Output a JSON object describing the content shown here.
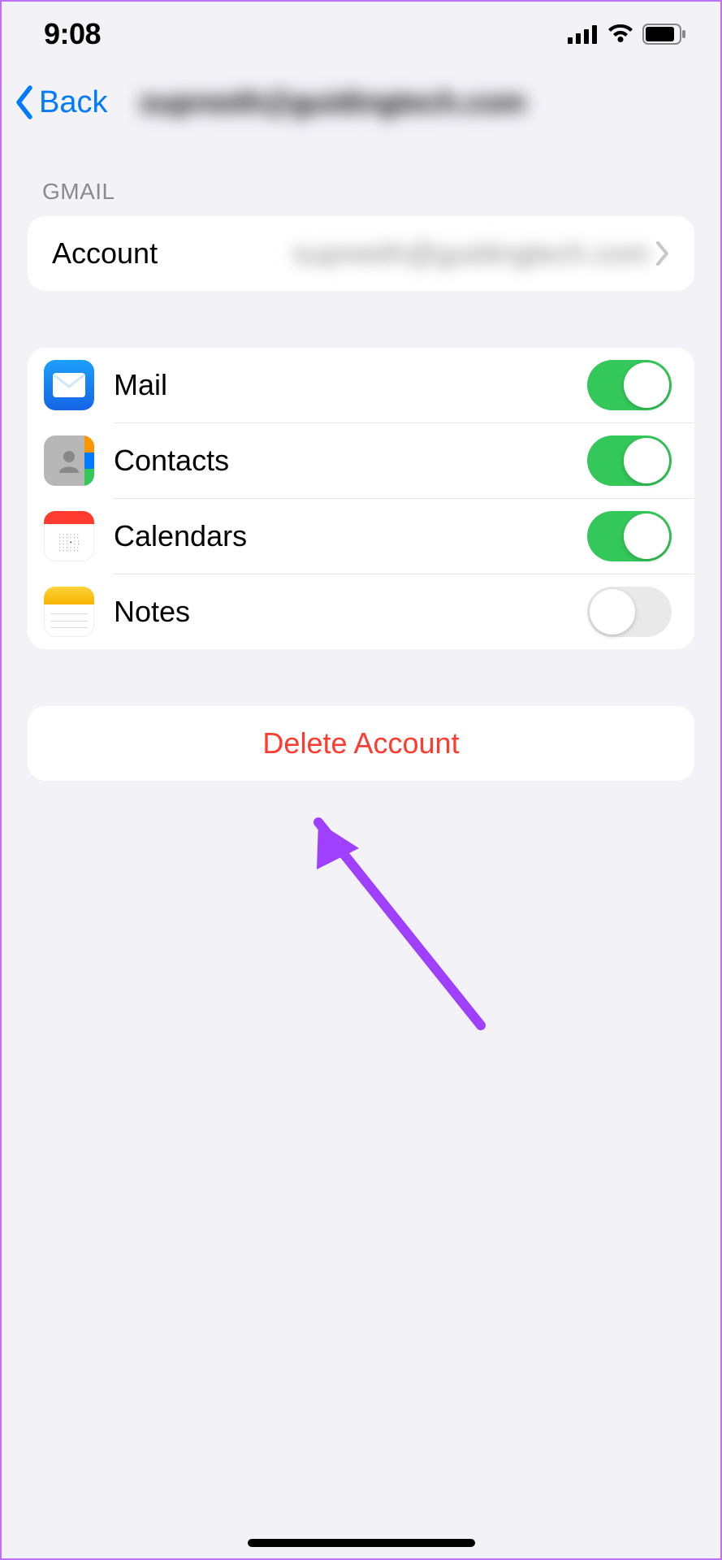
{
  "statusBar": {
    "time": "9:08"
  },
  "nav": {
    "back": "Back",
    "title": "supreeth@guidingtech.com"
  },
  "sections": {
    "gmailHeader": "GMAIL"
  },
  "account": {
    "label": "Account",
    "value": "supreeth@guidingtech.com"
  },
  "services": [
    {
      "id": "mail",
      "label": "Mail",
      "enabled": true
    },
    {
      "id": "contacts",
      "label": "Contacts",
      "enabled": true
    },
    {
      "id": "calendars",
      "label": "Calendars",
      "enabled": true
    },
    {
      "id": "notes",
      "label": "Notes",
      "enabled": false
    }
  ],
  "deleteButton": "Delete Account"
}
